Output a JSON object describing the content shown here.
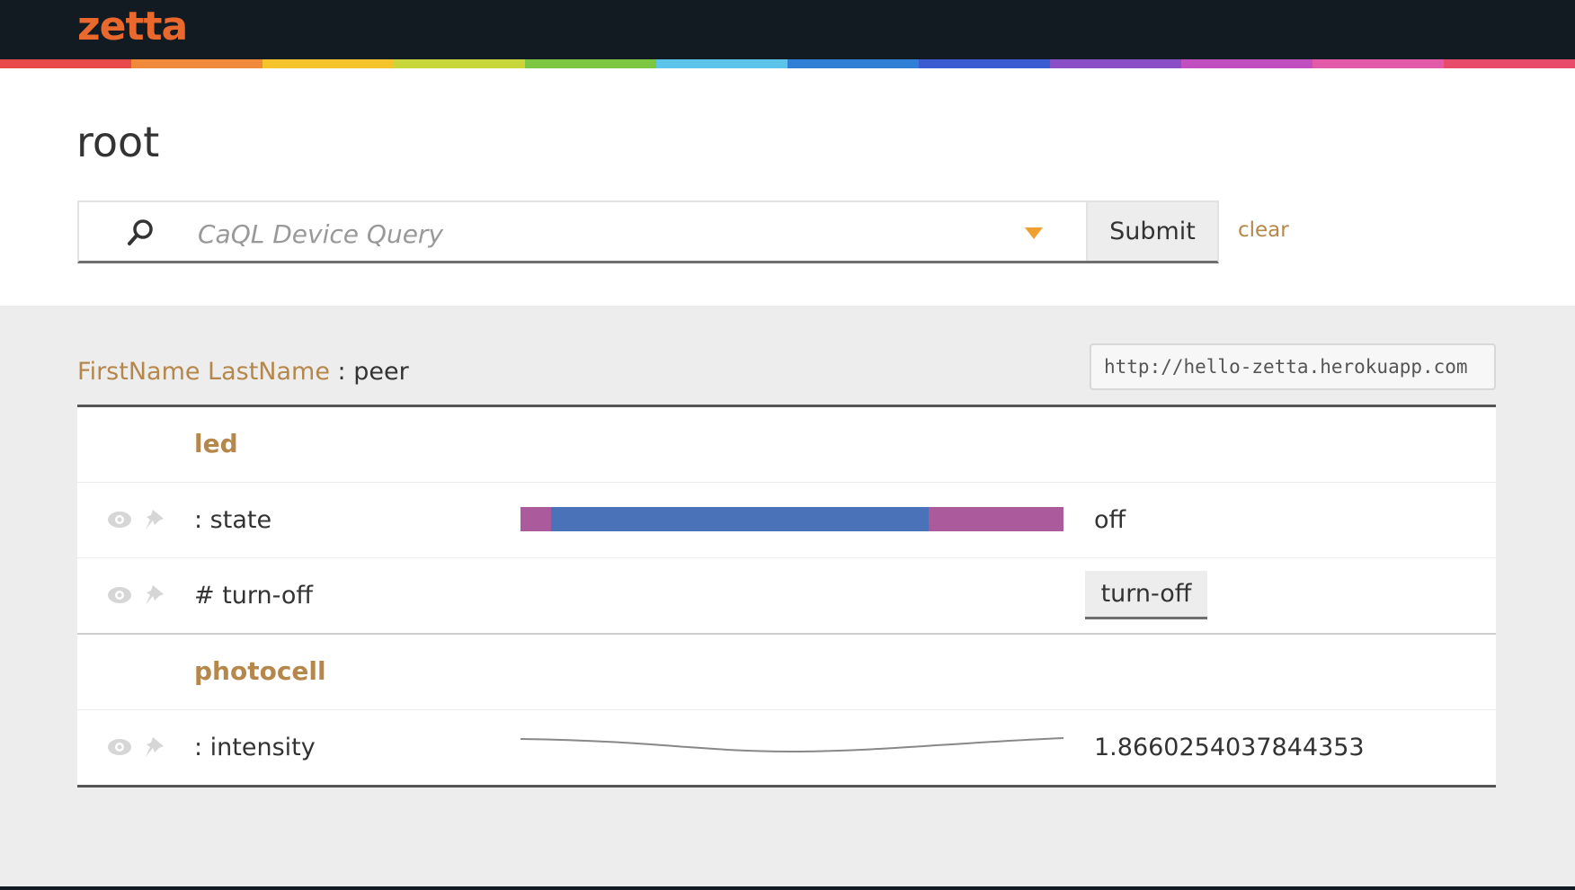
{
  "app": {
    "brand": "zetta",
    "rainbow_colors": [
      "#e84a4a",
      "#f08a3a",
      "#f5c32c",
      "#c9d63a",
      "#7cc642",
      "#5bc4e8",
      "#2f7fd6",
      "#3d5bd1",
      "#8a4fc7",
      "#c24fc0",
      "#e35aa8",
      "#e84a6a"
    ]
  },
  "page": {
    "title": "root"
  },
  "query": {
    "placeholder": "CaQL Device Query",
    "value": "",
    "submit_label": "Submit",
    "clear_label": "clear"
  },
  "server": {
    "name": "FirstName LastName",
    "role": " : peer",
    "url": "http://hello-zetta.herokuapp.com"
  },
  "devices": [
    {
      "name": "led",
      "rows": [
        {
          "label": ": state",
          "value": "off",
          "bar_colors": [
            "#ab5a9c",
            "#4a72b8",
            "#ab5a9c"
          ]
        },
        {
          "label": "# turn-off",
          "action_label": "turn-off"
        }
      ]
    },
    {
      "name": "photocell",
      "rows": [
        {
          "label": ": intensity",
          "value": "1.8660254037844353"
        }
      ]
    }
  ]
}
